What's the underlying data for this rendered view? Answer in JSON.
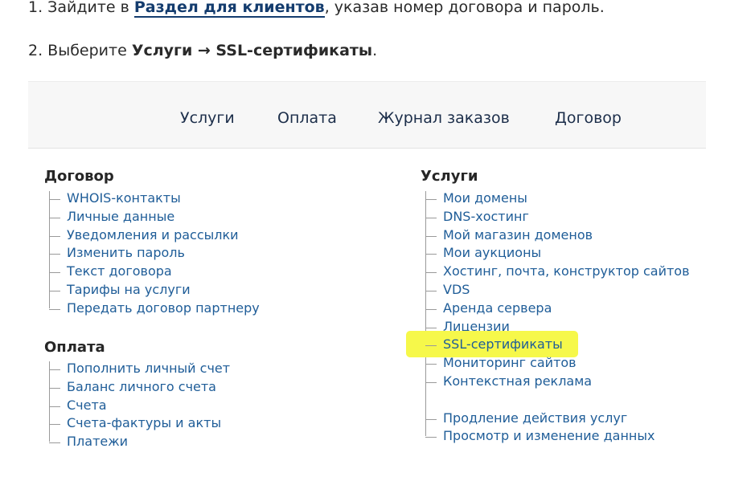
{
  "instructions": {
    "step1": {
      "prefix": "1. Зайдите в ",
      "link": "Раздел для клиентов",
      "suffix": ", указав номер договора и пароль."
    },
    "step2": {
      "prefix": "2. Выберите ",
      "path": "Услуги → SSL-сертификаты",
      "suffix": "."
    }
  },
  "topnav": {
    "items": [
      "Услуги",
      "Оплата",
      "Журнал заказов",
      "Договор"
    ]
  },
  "sections": {
    "contract": {
      "title": "Договор",
      "items": [
        "WHOIS-контакты",
        "Личные данные",
        "Уведомления и рассылки",
        "Изменить пароль",
        "Текст договора",
        "Тарифы на услуги",
        "Передать договор партнеру"
      ]
    },
    "payment": {
      "title": "Оплата",
      "items": [
        "Пополнить личный счет",
        "Баланс личного счета",
        "Счета",
        "Счета-фактуры и акты",
        "Платежи"
      ]
    },
    "services": {
      "title": "Услуги",
      "items": [
        "Мои домены",
        "DNS-хостинг",
        "Мой магазин доменов",
        "Мои аукционы",
        "Хостинг, почта, конструктор сайтов",
        "VDS",
        "Аренда сервера",
        "Лицензии",
        "SSL-сертификаты",
        "Мониторинг сайтов",
        "Контекстная реклама"
      ],
      "extra_items": [
        "Продление действия услуг",
        "Просмотр и изменение данных"
      ]
    }
  },
  "colors": {
    "link": "#1f5d98",
    "highlight": "#f6f84a",
    "nav_text": "#1c2e4a",
    "nav_bg": "#f7f7f7"
  }
}
